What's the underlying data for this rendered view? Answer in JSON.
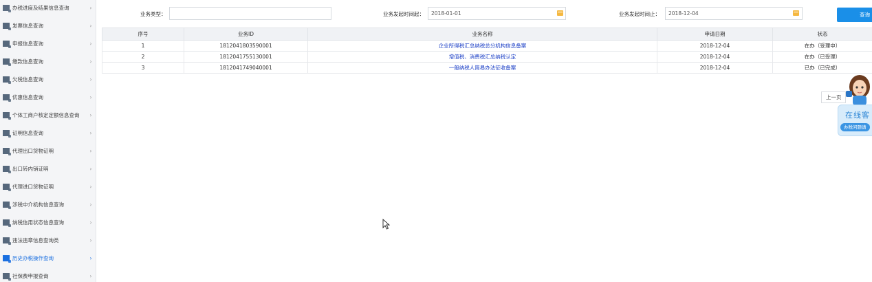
{
  "sidebar": {
    "items": [
      {
        "label": "办税进度及结果信息查询",
        "icon": "progress-icon",
        "color": "#5c6d82",
        "active": false
      },
      {
        "label": "发票信息查询",
        "icon": "invoice-icon",
        "color": "#56687c",
        "active": false
      },
      {
        "label": "申报信息查询",
        "icon": "declare-icon",
        "color": "#56687c",
        "active": false
      },
      {
        "label": "缴款信息查询",
        "icon": "payment-icon",
        "color": "#56687c",
        "active": false
      },
      {
        "label": "欠税信息查询",
        "icon": "arrears-icon",
        "color": "#56687c",
        "active": false
      },
      {
        "label": "优惠信息查询",
        "icon": "discount-icon",
        "color": "#56687c",
        "active": false
      },
      {
        "label": "个体工商户核定定额信息查询",
        "icon": "business-icon",
        "color": "#56687c",
        "active": false
      },
      {
        "label": "证明信息查询",
        "icon": "certificate-icon",
        "color": "#56687c",
        "active": false
      },
      {
        "label": "代理出口货物证明",
        "icon": "export-agent-icon",
        "color": "#56687c",
        "active": false
      },
      {
        "label": "出口转内销证明",
        "icon": "export-domestic-icon",
        "color": "#56687c",
        "active": false
      },
      {
        "label": "代理进口货物证明",
        "icon": "import-agent-icon",
        "color": "#56687c",
        "active": false
      },
      {
        "label": "涉税中介机构信息查询",
        "icon": "agency-icon",
        "color": "#56687c",
        "active": false
      },
      {
        "label": "纳税信用状态信息查询",
        "icon": "credit-icon",
        "color": "#56687c",
        "active": false
      },
      {
        "label": "违法违章信息查询类",
        "icon": "violation-icon",
        "color": "#56687c",
        "active": false
      },
      {
        "label": "历史办税操作查询",
        "icon": "history-icon",
        "color": "#1a6fe0",
        "active": true
      },
      {
        "label": "社保费申报查询",
        "icon": "social-security-icon",
        "color": "#56687c",
        "active": false
      }
    ],
    "chevron": "›"
  },
  "filters": {
    "business_type_label": "业务类型：",
    "business_type_value": "",
    "start_label": "业务发起时间起：",
    "start_value": "2018-01-01",
    "end_label": "业务发起时间止：",
    "end_value": "2018-12-04",
    "query_button": "查询"
  },
  "table": {
    "headers": [
      "序号",
      "业务ID",
      "业务名称",
      "申请日期",
      "状态"
    ],
    "rows": [
      {
        "index": "1",
        "id": "1812041803590001",
        "name": "企业所得税汇总纳税总分机构信息备案",
        "date": "2018-12-04",
        "status": "在办（受理中）"
      },
      {
        "index": "2",
        "id": "1812041755130001",
        "name": "增值税、消费税汇总纳税认定",
        "date": "2018-12-04",
        "status": "在办（已受理）"
      },
      {
        "index": "3",
        "id": "1812041749040001",
        "name": "一般纳税人简易办法征收备案",
        "date": "2018-12-04",
        "status": "已办（已完成）"
      }
    ]
  },
  "pager": {
    "prev": "上一页"
  },
  "online_service": {
    "title": "在线客",
    "subtitle": "办税问题请"
  },
  "colors": {
    "accent": "#1a6fe0",
    "button": "#1a8fe8",
    "link": "#1a3ec6",
    "calendar": "#f5b841"
  }
}
